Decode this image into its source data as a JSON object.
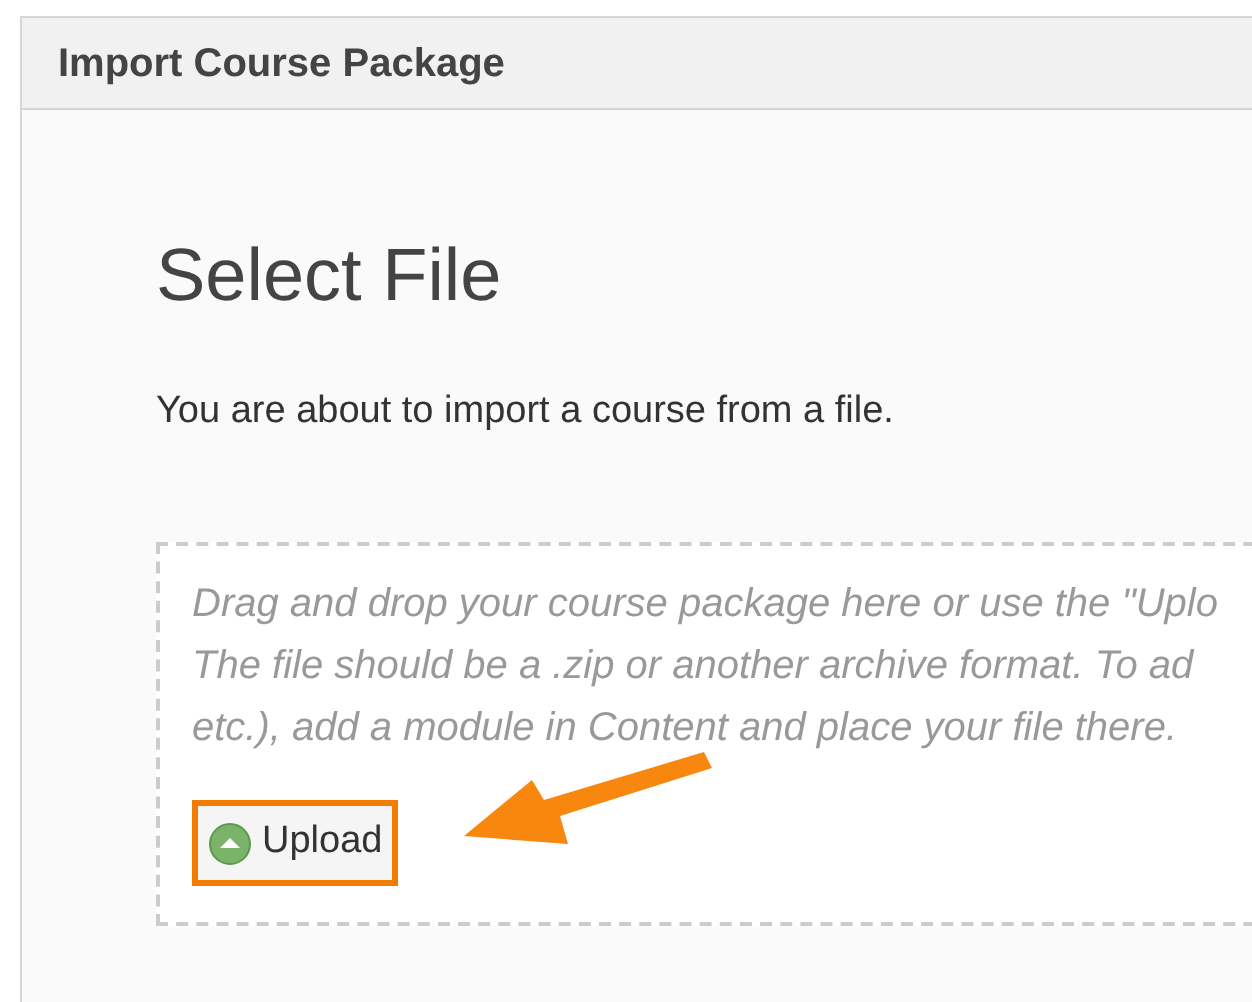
{
  "window": {
    "title": "Import Course Package"
  },
  "heading": "Select File",
  "intro": "You are about to import a course from a file.",
  "dropzone": {
    "lines": [
      "Drag and drop your course package here or use the \"Uplo",
      "The file should be a .zip or another archive format. To ad",
      "etc.), add a module in Content and place your file there."
    ],
    "upload_button": {
      "label": "Upload",
      "highlighted": true
    }
  }
}
